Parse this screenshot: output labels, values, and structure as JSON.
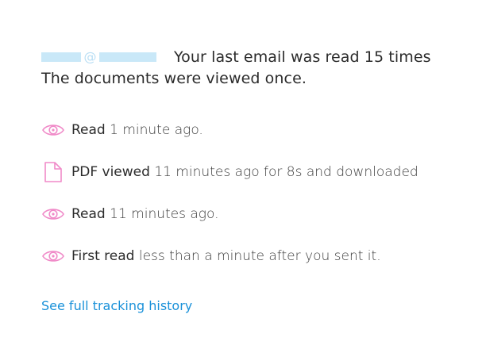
{
  "summary": {
    "redacted_email_symbol": "@",
    "line1": "Your last email was read 15 times",
    "line2": "The documents were viewed once."
  },
  "events": [
    {
      "icon": "eye-icon",
      "label": "Read",
      "detail": " 1 minute ago."
    },
    {
      "icon": "document-icon",
      "label": "PDF viewed",
      "detail": " 11 minutes ago for 8s and downloaded"
    },
    {
      "icon": "eye-icon",
      "label": "Read",
      "detail": " 11 minutes ago."
    },
    {
      "icon": "eye-icon",
      "label": "First read",
      "detail": " less than a minute after you sent it."
    }
  ],
  "link": {
    "label": "See full tracking history"
  },
  "colors": {
    "icon_accent": "#f08ac8",
    "link": "#1a91d9",
    "redaction": "#c9e8f8"
  }
}
